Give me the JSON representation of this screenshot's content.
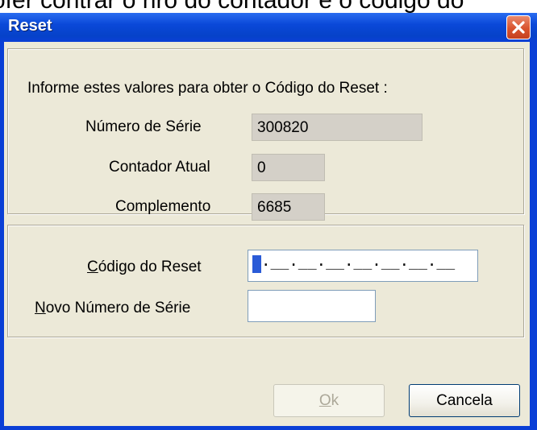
{
  "background_text": "ofer contrar o nro do contador e o código do",
  "window": {
    "title": "Reset",
    "close_icon": "close-icon"
  },
  "info_group": {
    "instruction": "Informe estes valores para obter o Código do Reset :",
    "fields": [
      {
        "label": "Número de Série",
        "value": "300820"
      },
      {
        "label": "Contador Atual",
        "value": "0"
      },
      {
        "label": "Complemento",
        "value": "6685"
      }
    ]
  },
  "input_group": {
    "reset_code": {
      "label_accel": "C",
      "label_rest": "ódigo do Reset",
      "mask": ".__.__.__.__.__.__.__"
    },
    "new_serial": {
      "label_accel": "N",
      "label_rest": "ovo Número de Série",
      "value": ""
    }
  },
  "buttons": {
    "ok": {
      "accel": "O",
      "rest": "k",
      "enabled": false
    },
    "cancel": "Cancela"
  }
}
